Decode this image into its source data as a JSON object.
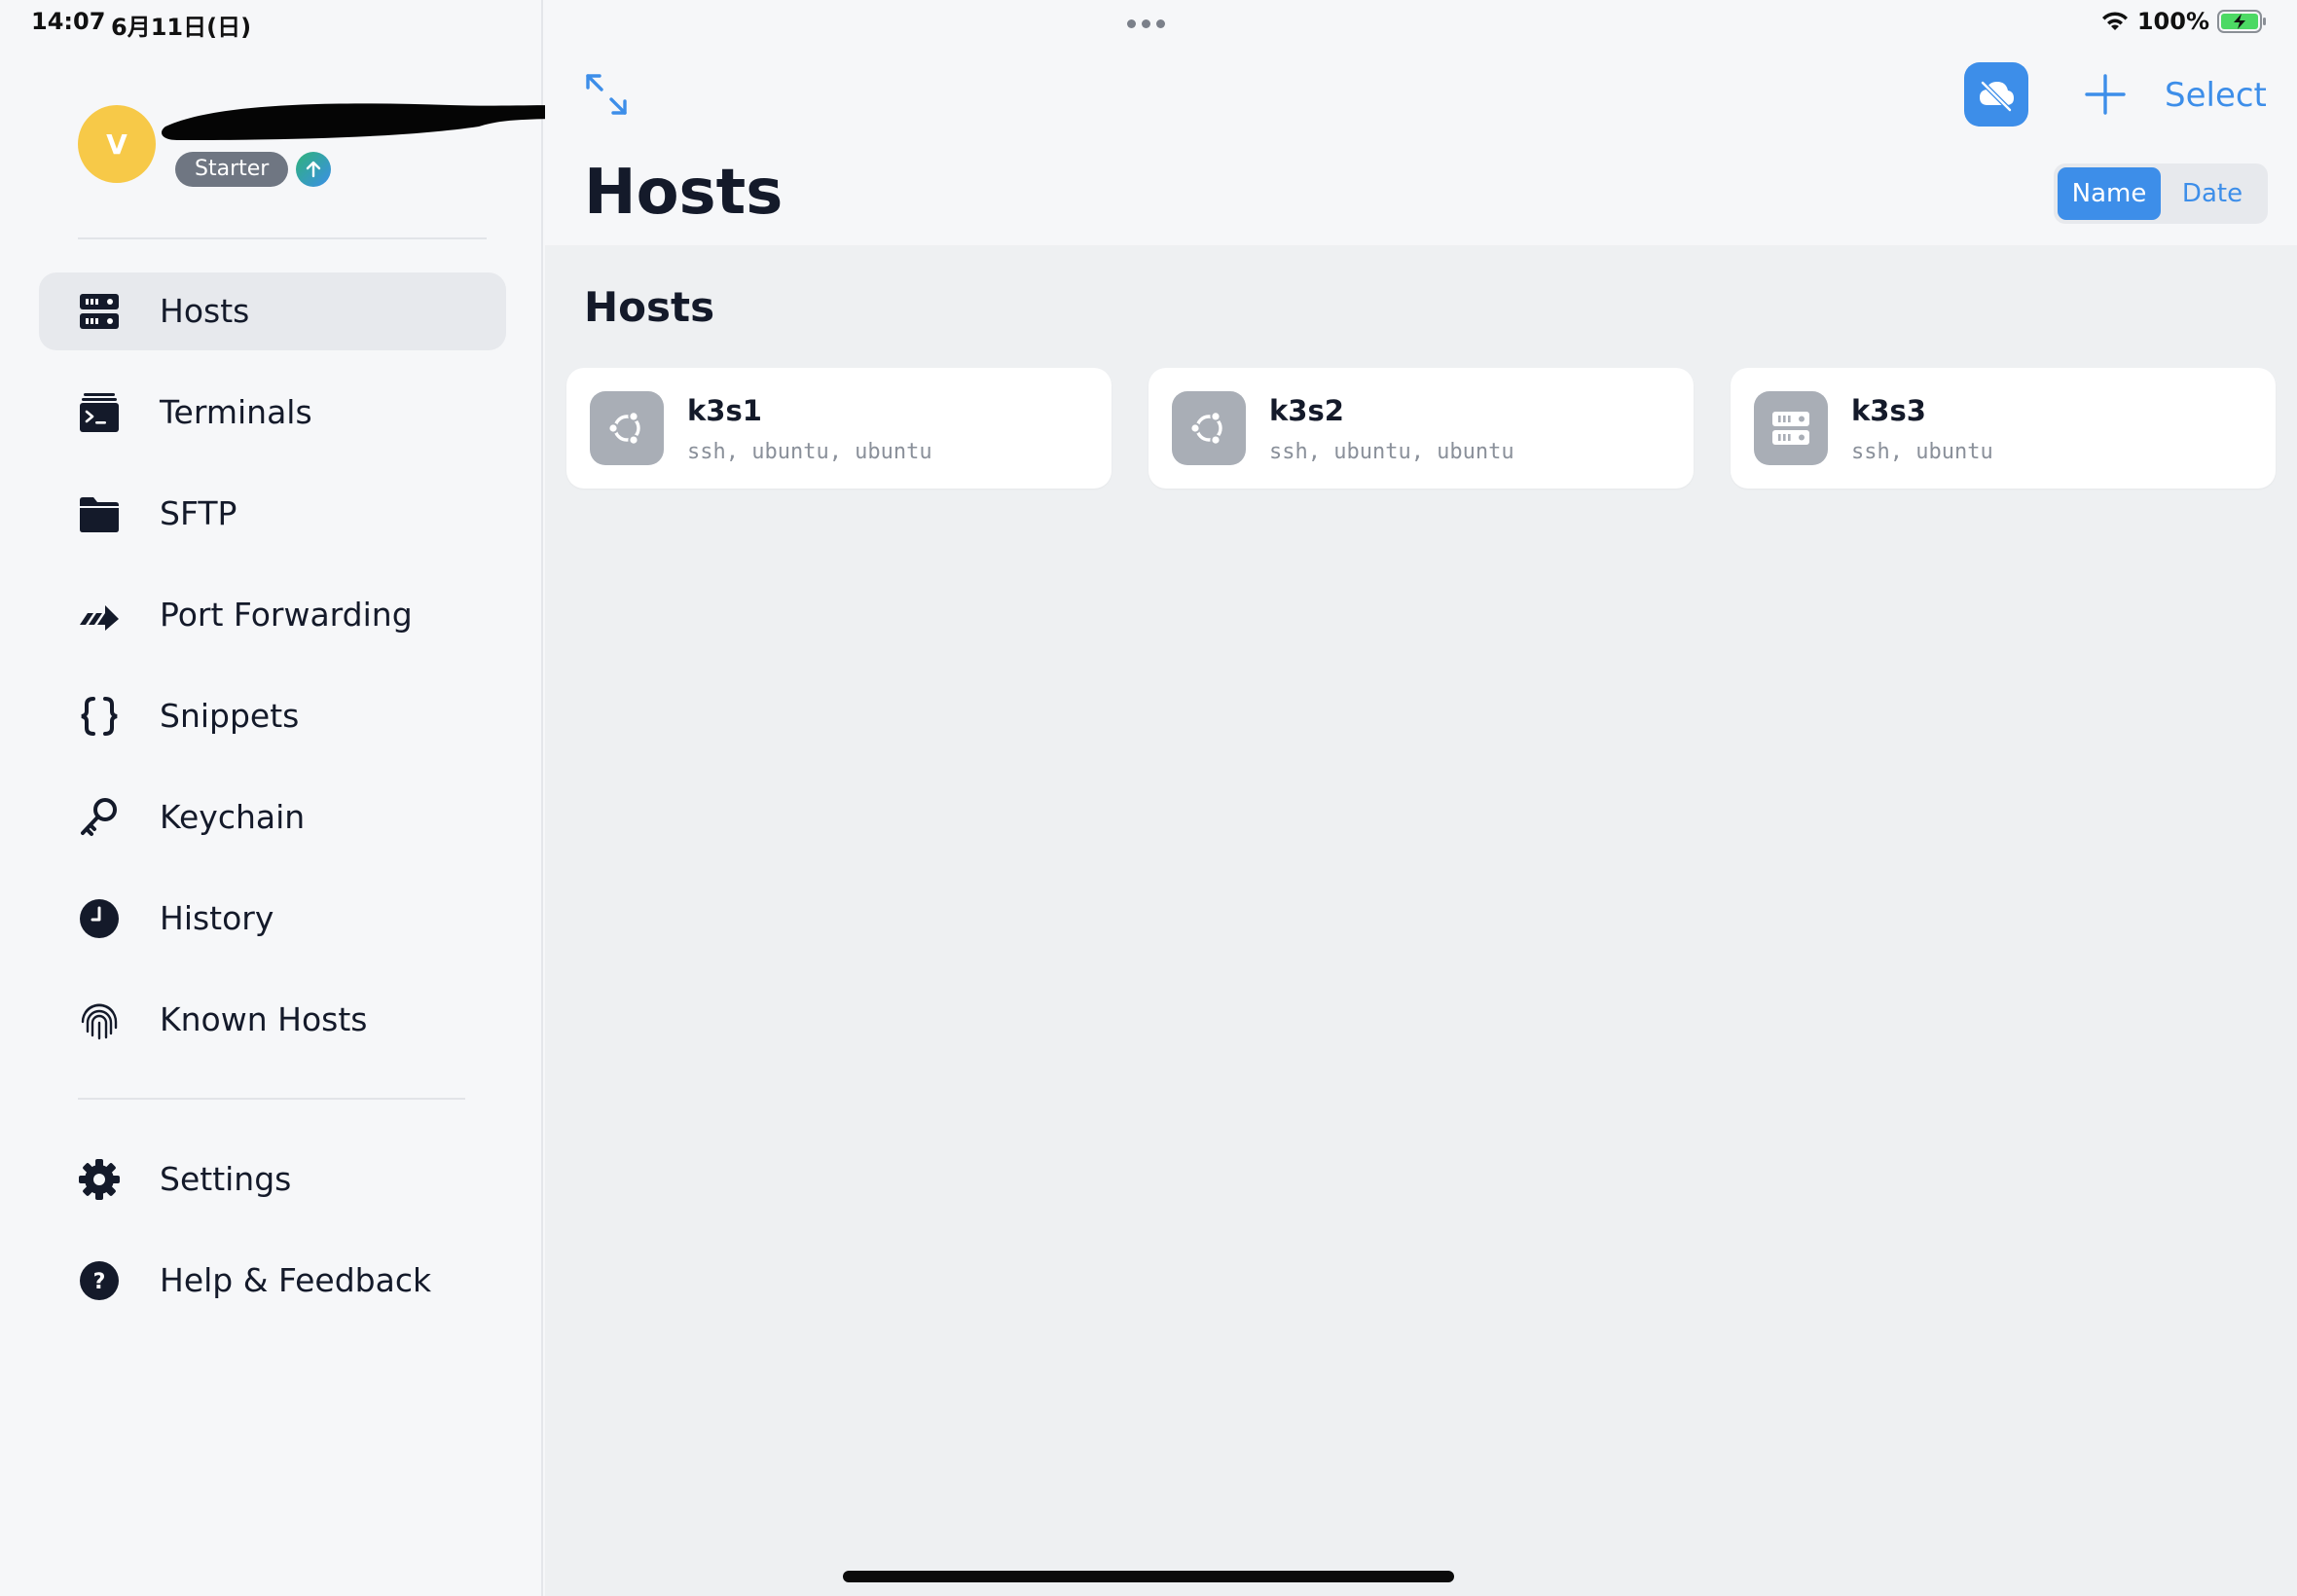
{
  "status_bar": {
    "time": "14:07",
    "date": "6月11日(日)",
    "battery": "100%"
  },
  "profile": {
    "avatar_initial": "V",
    "plan": "Starter"
  },
  "sidebar": {
    "items": [
      {
        "label": "Hosts",
        "icon": "server-icon",
        "active": true
      },
      {
        "label": "Terminals",
        "icon": "terminal-icon"
      },
      {
        "label": "SFTP",
        "icon": "folder-icon"
      },
      {
        "label": "Port Forwarding",
        "icon": "port-forward-icon"
      },
      {
        "label": "Snippets",
        "icon": "braces-icon"
      },
      {
        "label": "Keychain",
        "icon": "key-icon"
      },
      {
        "label": "History",
        "icon": "clock-icon"
      },
      {
        "label": "Known Hosts",
        "icon": "fingerprint-icon"
      }
    ],
    "footer_items": [
      {
        "label": "Settings",
        "icon": "gear-icon"
      },
      {
        "label": "Help & Feedback",
        "icon": "help-icon"
      }
    ]
  },
  "header": {
    "title": "Hosts",
    "select_label": "Select",
    "sort_options": [
      "Name",
      "Date"
    ],
    "sort_selected": "Name"
  },
  "section": {
    "title": "Hosts"
  },
  "hosts": [
    {
      "name": "k3s1",
      "details": "ssh, ubuntu, ubuntu",
      "icon": "ubuntu-icon"
    },
    {
      "name": "k3s2",
      "details": "ssh, ubuntu, ubuntu",
      "icon": "ubuntu-icon"
    },
    {
      "name": "k3s3",
      "details": "ssh, ubuntu",
      "icon": "server-icon"
    }
  ],
  "colors": {
    "accent": "#3d8ee9",
    "avatar": "#f7c948",
    "badge": "#6f7682",
    "host_icon_bg": "#a9aeb6"
  }
}
